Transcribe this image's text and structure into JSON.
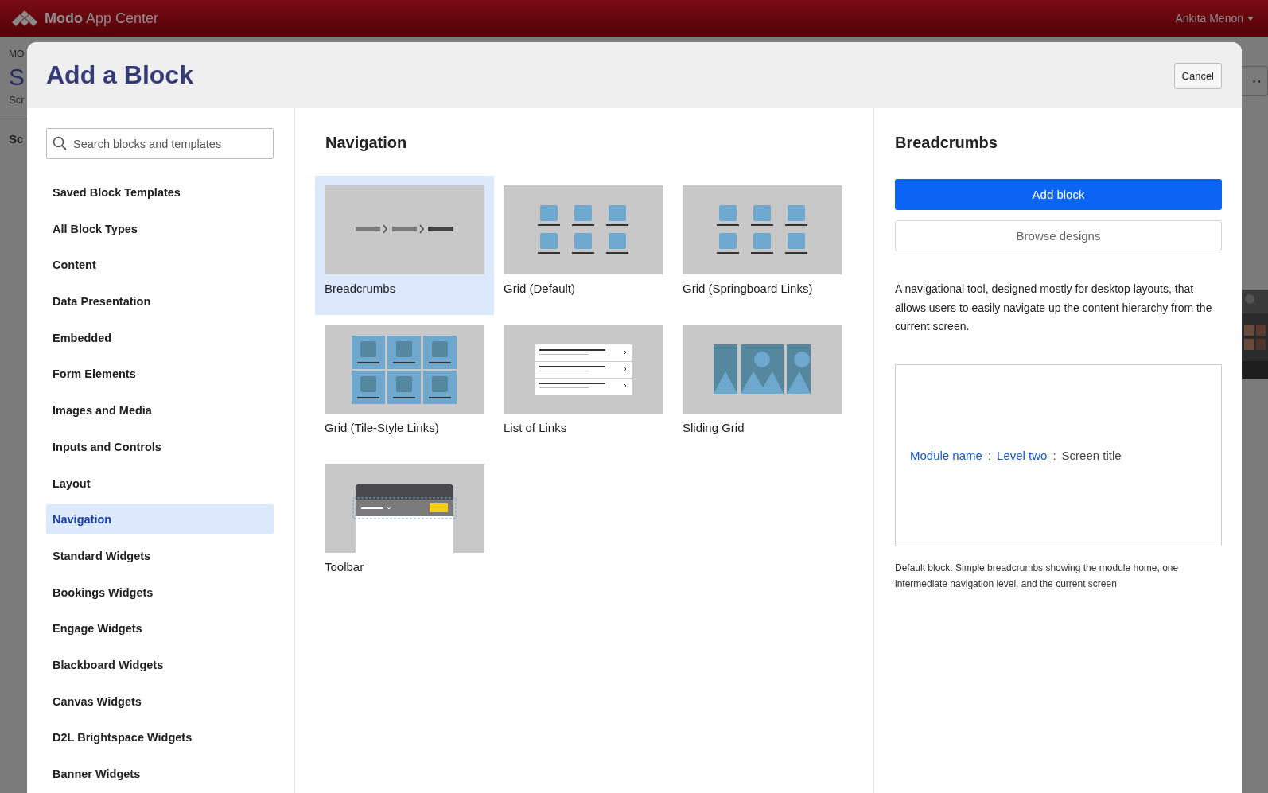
{
  "top_bar": {
    "app_name": "**Modo** App Center",
    "user": "Ankita Menon"
  },
  "background_page": {
    "texts": [
      "MO",
      "S",
      "Scr",
      "Sc"
    ]
  },
  "dialog": {
    "title": "Add a Block",
    "cancel_button": "Cancel",
    "search": {
      "placeholder": "Search blocks and templates"
    },
    "categories": [
      {
        "label": "Saved Block Templates",
        "selected": false
      },
      {
        "label": "All Block Types",
        "selected": false
      },
      {
        "label": "Content",
        "selected": false
      },
      {
        "label": "Data Presentation",
        "selected": false
      },
      {
        "label": "Embedded",
        "selected": false
      },
      {
        "label": "Form Elements",
        "selected": false
      },
      {
        "label": "Images and Media",
        "selected": false
      },
      {
        "label": "Inputs and Controls",
        "selected": false
      },
      {
        "label": "Layout",
        "selected": false
      },
      {
        "label": "Navigation",
        "selected": true
      },
      {
        "label": "Standard Widgets",
        "selected": false
      },
      {
        "label": "Bookings Widgets",
        "selected": false
      },
      {
        "label": "Engage Widgets",
        "selected": false
      },
      {
        "label": "Blackboard Widgets",
        "selected": false
      },
      {
        "label": "Canvas Widgets",
        "selected": false
      },
      {
        "label": "D2L Brightspace Widgets",
        "selected": false
      },
      {
        "label": "Banner Widgets",
        "selected": false
      }
    ],
    "section_title": "Navigation",
    "blocks": [
      {
        "name": "Breadcrumbs",
        "kind": "breadcrumbs",
        "selected": true
      },
      {
        "name": "Grid (Default)",
        "kind": "grid",
        "selected": false
      },
      {
        "name": "Grid (Springboard Links)",
        "kind": "grid",
        "selected": false
      },
      {
        "name": "Grid (Tile-Style Links)",
        "kind": "tiles",
        "selected": false
      },
      {
        "name": "List of Links",
        "kind": "list",
        "selected": false
      },
      {
        "name": "Sliding Grid",
        "kind": "sliding",
        "selected": false
      },
      {
        "name": "Toolbar",
        "kind": "toolbar",
        "selected": false
      }
    ],
    "detail": {
      "title": "Breadcrumbs",
      "primary_button": "Add block",
      "secondary_button": "Browse designs",
      "description": "A navigational tool, designed mostly for desktop layouts, that allows users to easily navigate up the content hierarchy from the current screen.",
      "preview": [
        {
          "text": "Module name",
          "kind": "link"
        },
        {
          "text": ":",
          "kind": "separator"
        },
        {
          "text": "Level two",
          "kind": "link"
        },
        {
          "text": ":",
          "kind": "separator"
        },
        {
          "text": "Screen title",
          "kind": "current"
        }
      ],
      "caption": "Default block: Simple breadcrumbs showing the module home, one intermediate navigation level, and the current screen"
    }
  }
}
